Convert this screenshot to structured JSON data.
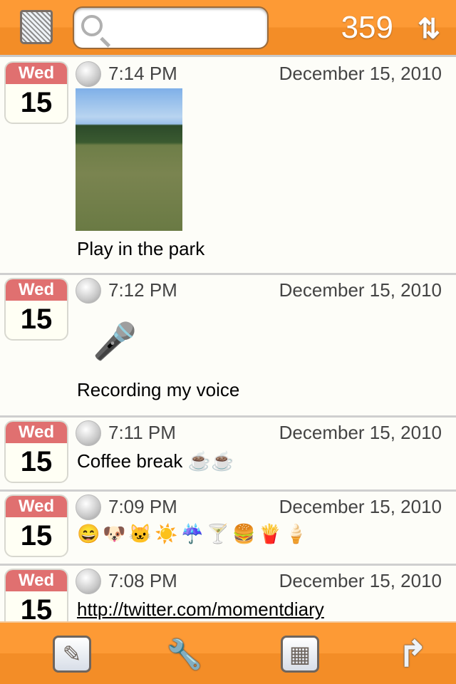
{
  "header": {
    "count": "359",
    "search_placeholder": "",
    "trash_icon": "trash-icon",
    "sort_icon": "sort-arrows-icon",
    "sort_glyph": "⇅"
  },
  "entries": [
    {
      "dow": "Wed",
      "day": "15",
      "time": "7:14 PM",
      "date": "December 15, 2010",
      "text": "Play in the park",
      "attachment": "photo"
    },
    {
      "dow": "Wed",
      "day": "15",
      "time": "7:12 PM",
      "date": "December 15, 2010",
      "text": "Recording my voice",
      "attachment": "voice-recording",
      "mic_glyph": "🎤"
    },
    {
      "dow": "Wed",
      "day": "15",
      "time": "7:11 PM",
      "date": "December 15, 2010",
      "text": "Coffee break ☕☕"
    },
    {
      "dow": "Wed",
      "day": "15",
      "time": "7:09 PM",
      "date": "December 15, 2010",
      "text": "😄🐶🐱☀️☔🍸🍔🍟🍦"
    },
    {
      "dow": "Wed",
      "day": "15",
      "time": "7:08 PM",
      "date": "December 15, 2010",
      "link": "http://twitter.com/momentdiary"
    }
  ],
  "toolbar": {
    "compose": "✎",
    "settings": "🔧",
    "calendar": "▦",
    "share": "↱"
  },
  "colors": {
    "bar": "#fd9a35",
    "calendar_header": "#e07070",
    "link": "#0000ee"
  }
}
